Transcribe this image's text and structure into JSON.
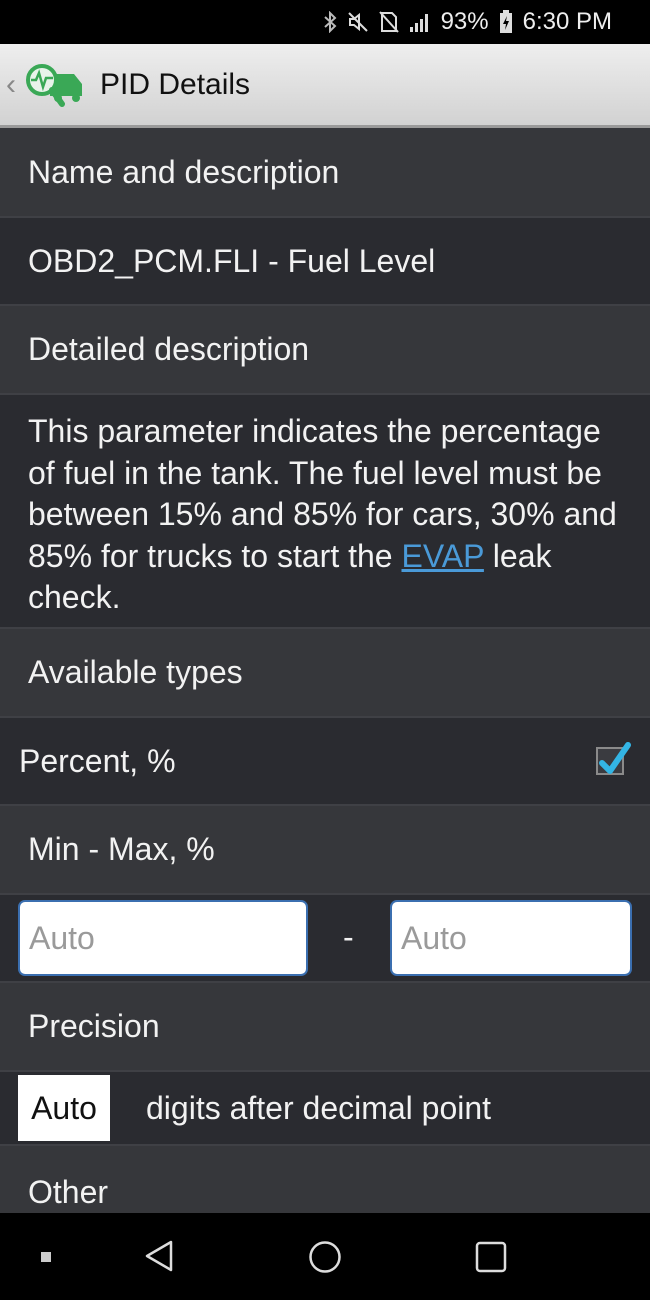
{
  "status": {
    "battery": "93%",
    "time": "6:30 PM"
  },
  "app_bar": {
    "title": "PID Details"
  },
  "sections": {
    "name_header": "Name and description",
    "name_value": "OBD2_PCM.FLI - Fuel Level",
    "detail_header": "Detailed description",
    "detail_text_before": "This parameter indicates the percentage of fuel in the tank. The fuel level must be between 15% and 85% for cars, 30% and 85% for trucks to start the ",
    "detail_link": "EVAP",
    "detail_text_after": " leak check.",
    "types_header": "Available types",
    "type_option": "Percent, %",
    "type_checked": true,
    "minmax_header": "Min - Max, %",
    "min_placeholder": "Auto",
    "separator": "-",
    "max_placeholder": "Auto",
    "precision_header": "Precision",
    "precision_value": "Auto",
    "precision_suffix": "digits after decimal point",
    "other_header": "Other"
  },
  "colors": {
    "accent": "#4a9ad8",
    "logo_green": "#3aa856"
  }
}
